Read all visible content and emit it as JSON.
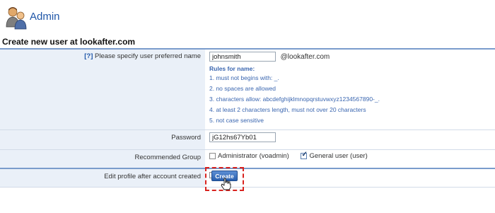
{
  "header": {
    "title": "Admin",
    "icon": "admin-users-icon"
  },
  "page": {
    "section_title": "Create new user at lookafter.com"
  },
  "form": {
    "username": {
      "help": "[?]",
      "label": "Please specify user preferred name",
      "value": "johnsmith",
      "domain": "@lookafter.com",
      "rules_title": "Rules for name:",
      "rules": [
        "1. must not begins with: _.",
        "2. no spaces are allowed",
        "3. characters allow: abcdefghijklmnopqrstuvwxyz1234567890-_.",
        "4. at least 2 characters length, must not over 20 characters",
        "5. not case sensitive"
      ]
    },
    "password": {
      "label": "Password",
      "value": "jG12hs67Yb01"
    },
    "group": {
      "label": "Recommended Group",
      "options": [
        {
          "label": "Administrator (voadmin)",
          "checked": false
        },
        {
          "label": "General user (user)",
          "checked": true
        }
      ]
    },
    "edit_profile": {
      "label": "Edit profile after account created",
      "checked": false
    },
    "submit_label": "Create"
  },
  "colors": {
    "accent": "#1f56a8",
    "highlight": "#d9231f",
    "label_bg": "#eaf0f8"
  }
}
